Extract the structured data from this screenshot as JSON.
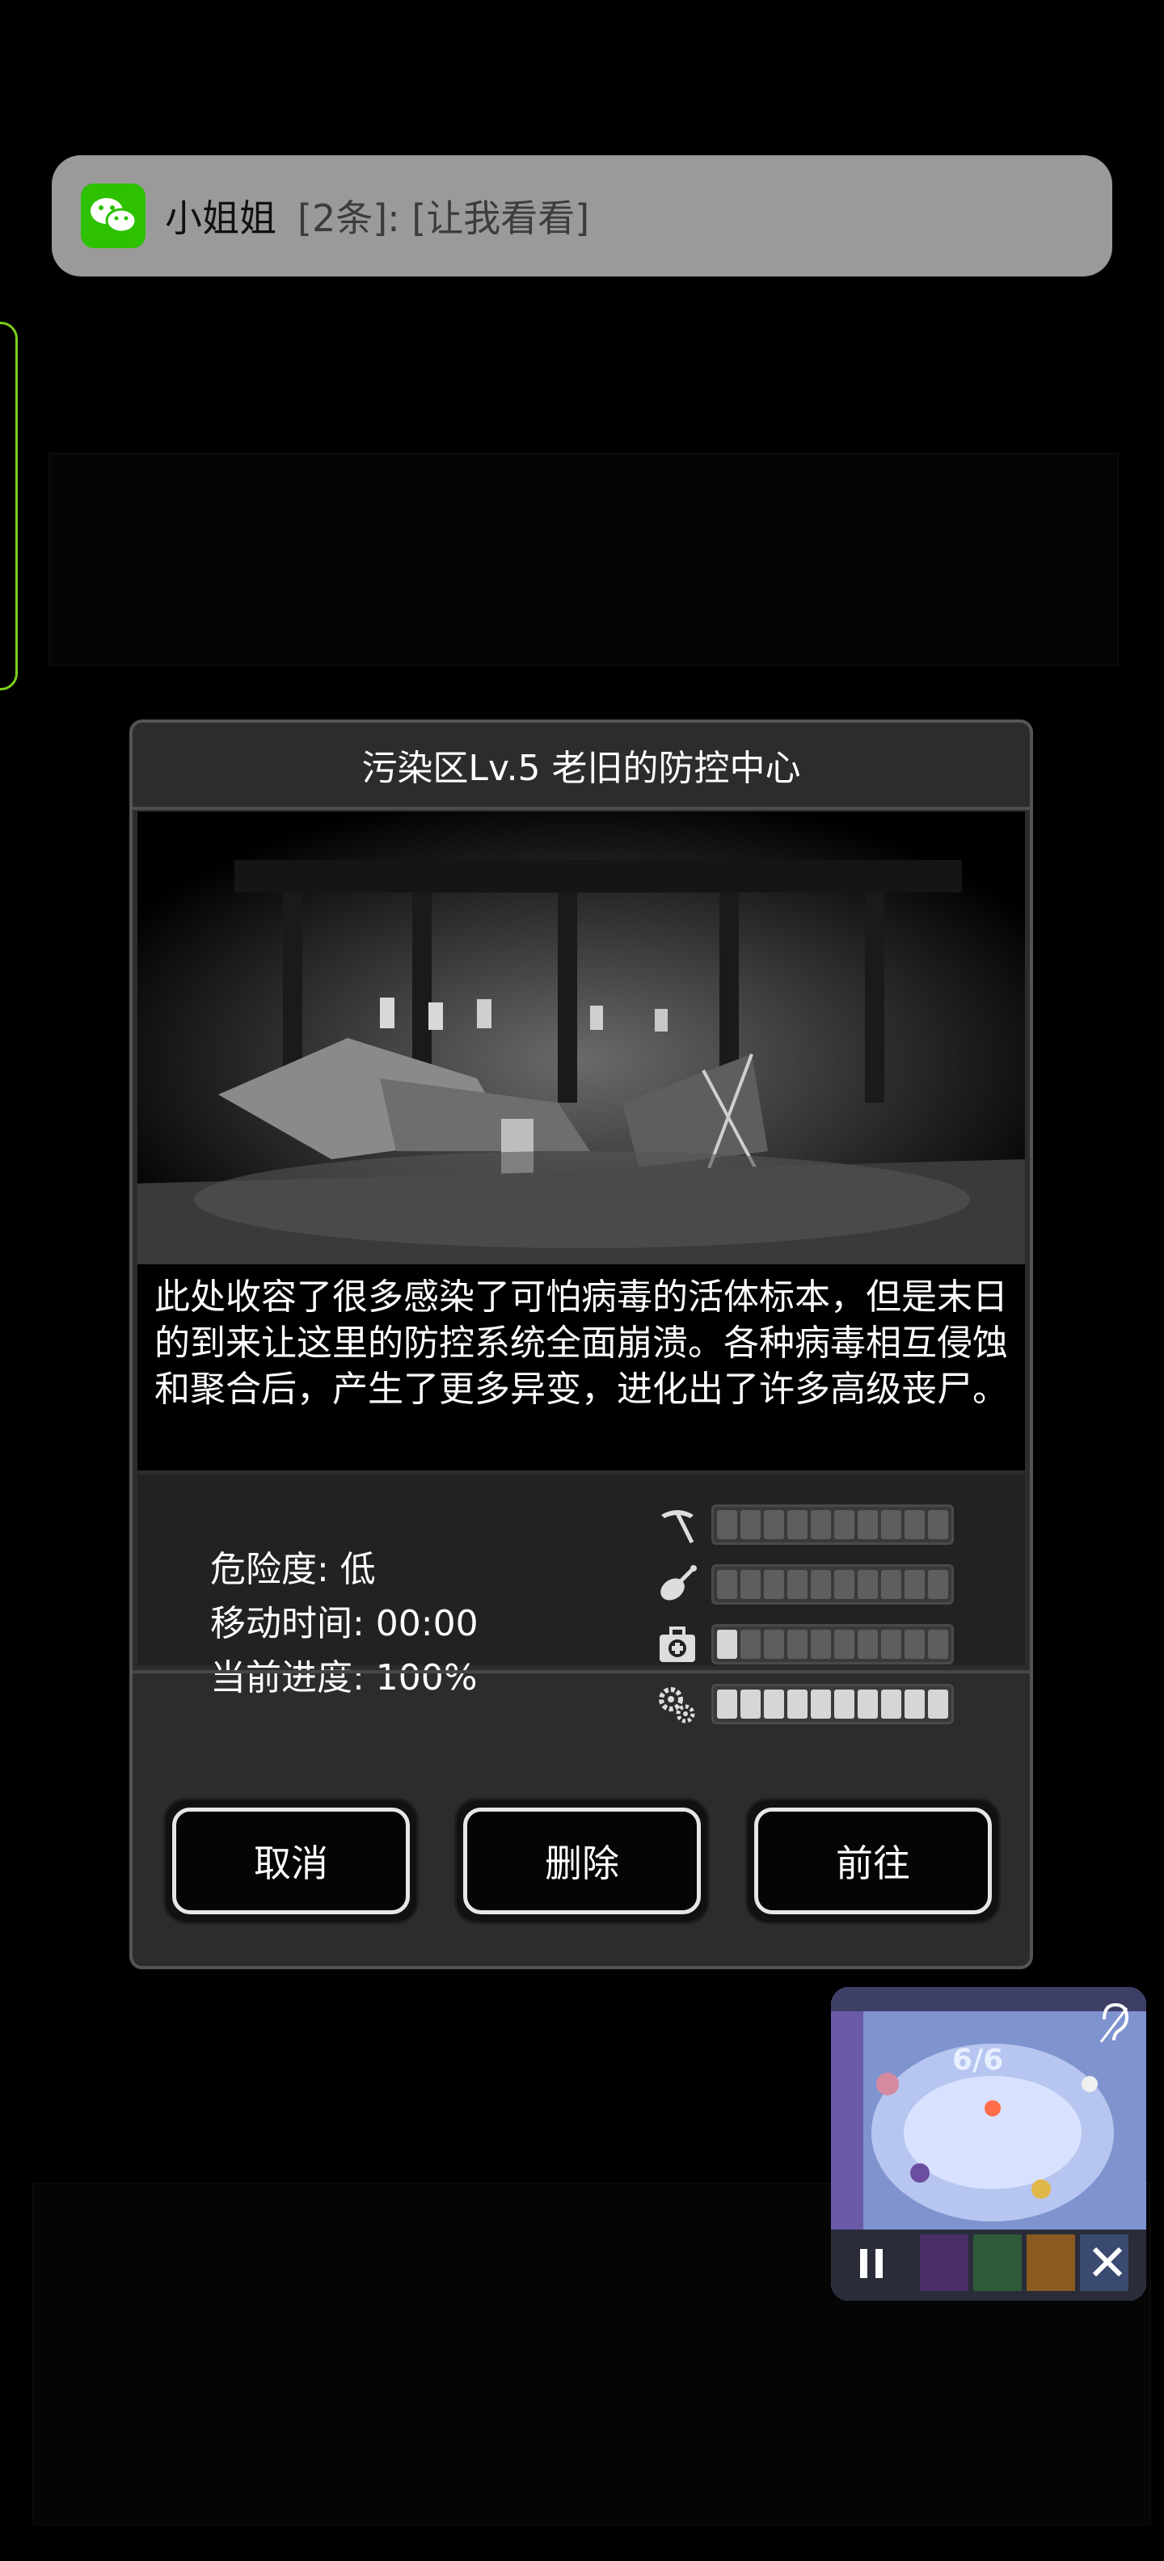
{
  "notification": {
    "app_icon": "wechat-icon",
    "sender": "小姐姐",
    "message": "[2条]: [让我看看]"
  },
  "dialog": {
    "title": "污染区Lv.5 老旧的防控中心",
    "description": "此处收容了很多感染了可怕病毒的活体标本，但是末日的到来让这里的防控系统全面崩溃。各种病毒相互侵蚀和聚合后，产生了更多异变，进化出了许多高级丧尸。",
    "stats": {
      "danger": "危险度: 低",
      "travel_time": "移动时间: 00:00",
      "progress": "当前进度: 100%"
    },
    "resource_bars": [
      {
        "icon": "pickaxe-icon",
        "filled_segments": 0,
        "total_segments": 10
      },
      {
        "icon": "drumstick-icon",
        "filled_segments": 0,
        "total_segments": 10
      },
      {
        "icon": "medkit-icon",
        "filled_segments": 1,
        "total_segments": 10
      },
      {
        "icon": "gears-icon",
        "filled_segments": 10,
        "total_segments": 10
      }
    ],
    "buttons": {
      "cancel": "取消",
      "delete": "删除",
      "go": "前往"
    }
  },
  "pip_window": {
    "score": "6/6",
    "controls": [
      "pause-icon",
      "close-icon",
      "ear-icon"
    ]
  }
}
